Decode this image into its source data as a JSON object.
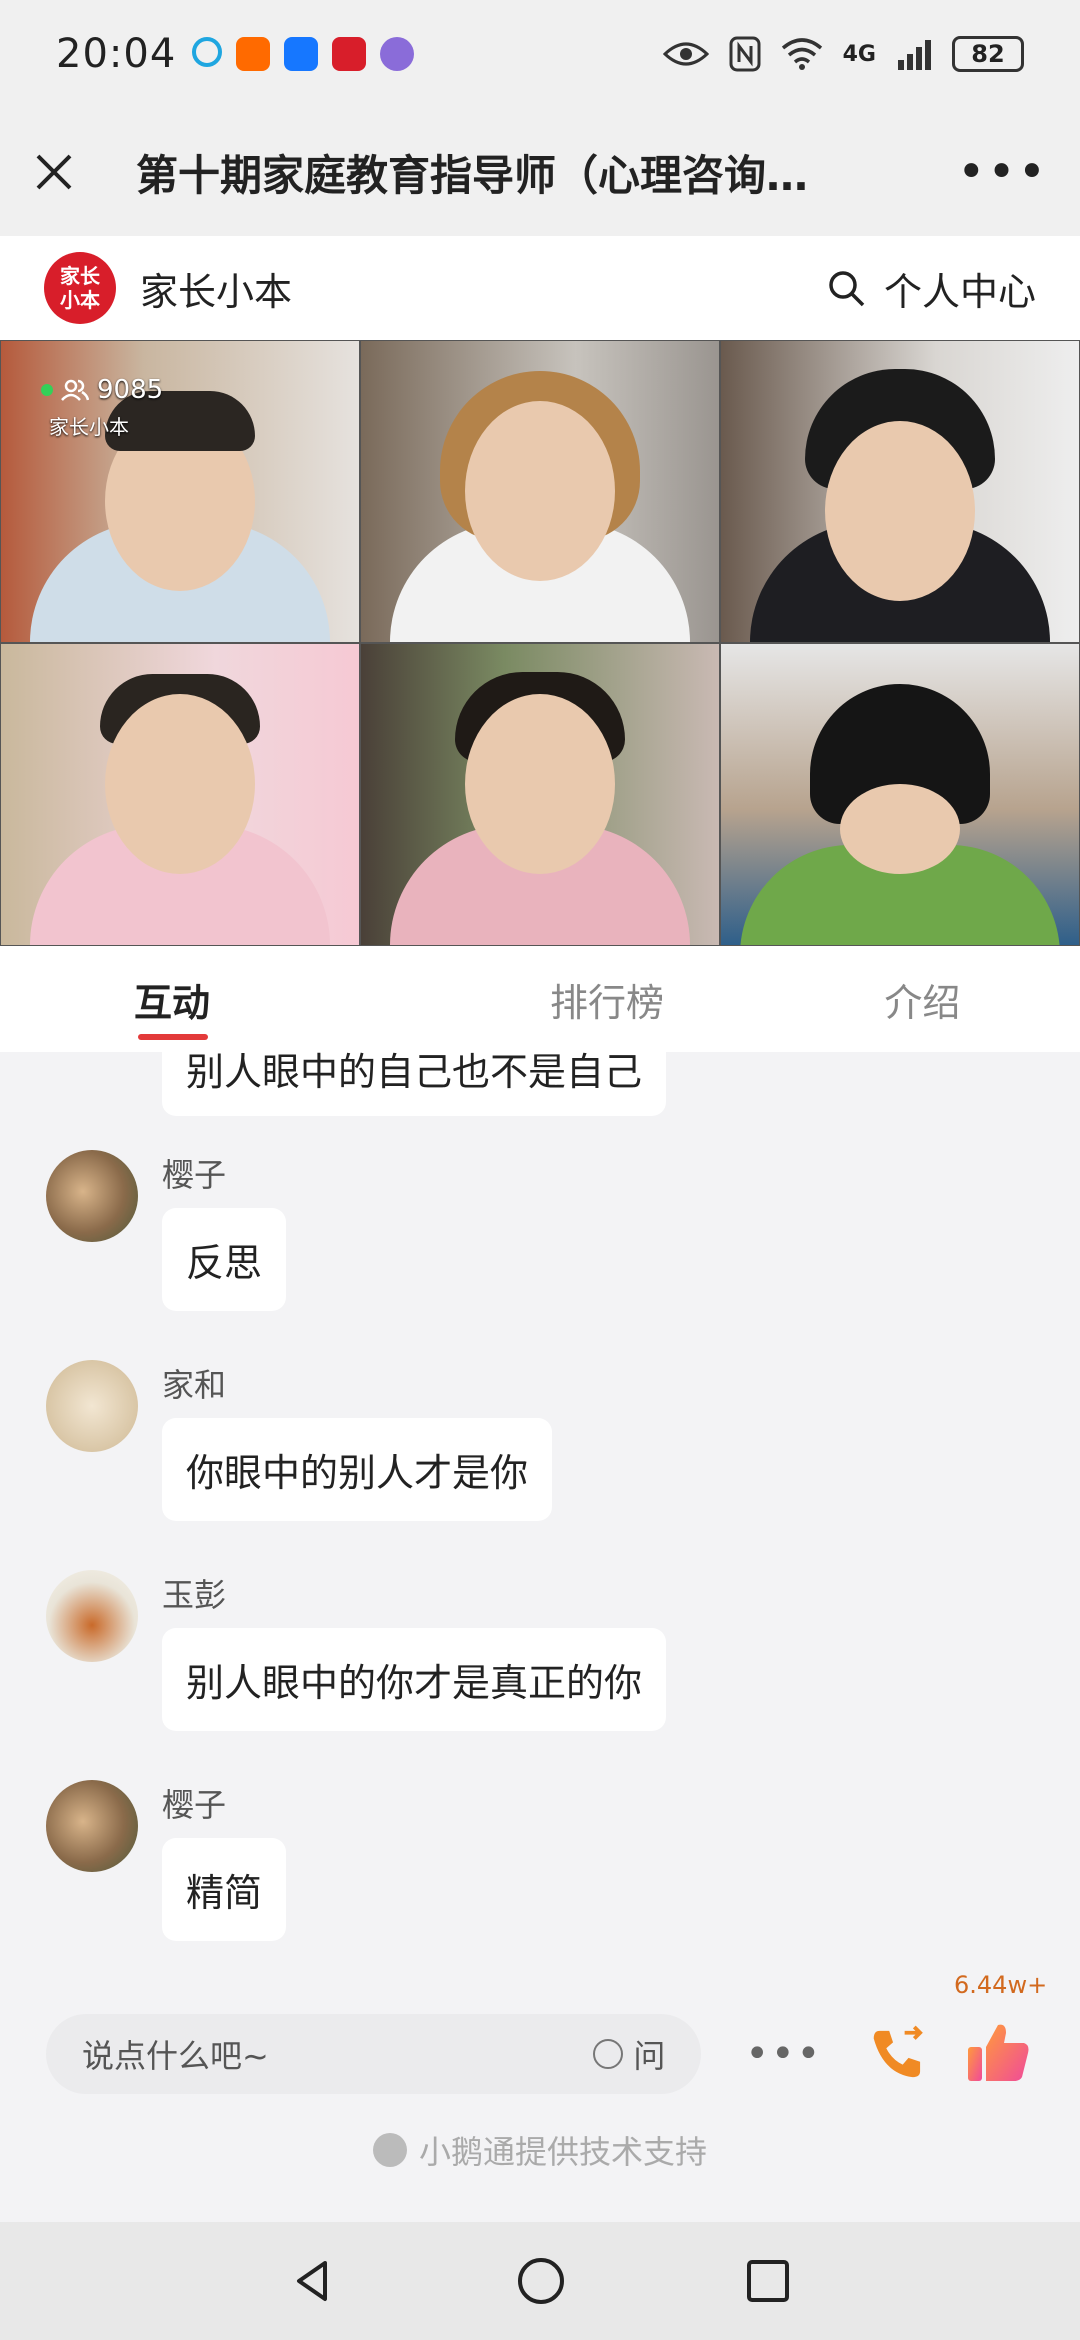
{
  "status_bar": {
    "time": "20:04",
    "network": "4G",
    "battery": "82"
  },
  "title_bar": {
    "title": "第十期家庭教育指导师（心理咨询…",
    "more": "•••"
  },
  "brand": {
    "logo_text": "家长小本",
    "name": "家长小本",
    "personal_center": "个人中心"
  },
  "video": {
    "viewer_count": "9085",
    "tile_brand": "家长小本"
  },
  "tabs": [
    {
      "label": "互动",
      "active": true
    },
    {
      "label": "排行榜",
      "active": false
    },
    {
      "label": "介绍",
      "active": false
    }
  ],
  "chat": {
    "partial_text": "别人眼中的自己也不是自己",
    "messages": [
      {
        "name": "樱子",
        "text": "反思"
      },
      {
        "name": "家和",
        "text": "你眼中的别人才是你"
      },
      {
        "name": "玉彭",
        "text": "别人眼中的你才是真正的你"
      },
      {
        "name": "樱子",
        "text": "精简"
      }
    ]
  },
  "input": {
    "placeholder": "说点什么吧~",
    "ask_label": "问",
    "more": "•••",
    "like_count": "6.44w+"
  },
  "powered_by": "小鹅通提供技术支持",
  "colors": {
    "accent": "#e33a3a",
    "brand_red": "#d81e2a",
    "like_orange": "#f08a24"
  }
}
